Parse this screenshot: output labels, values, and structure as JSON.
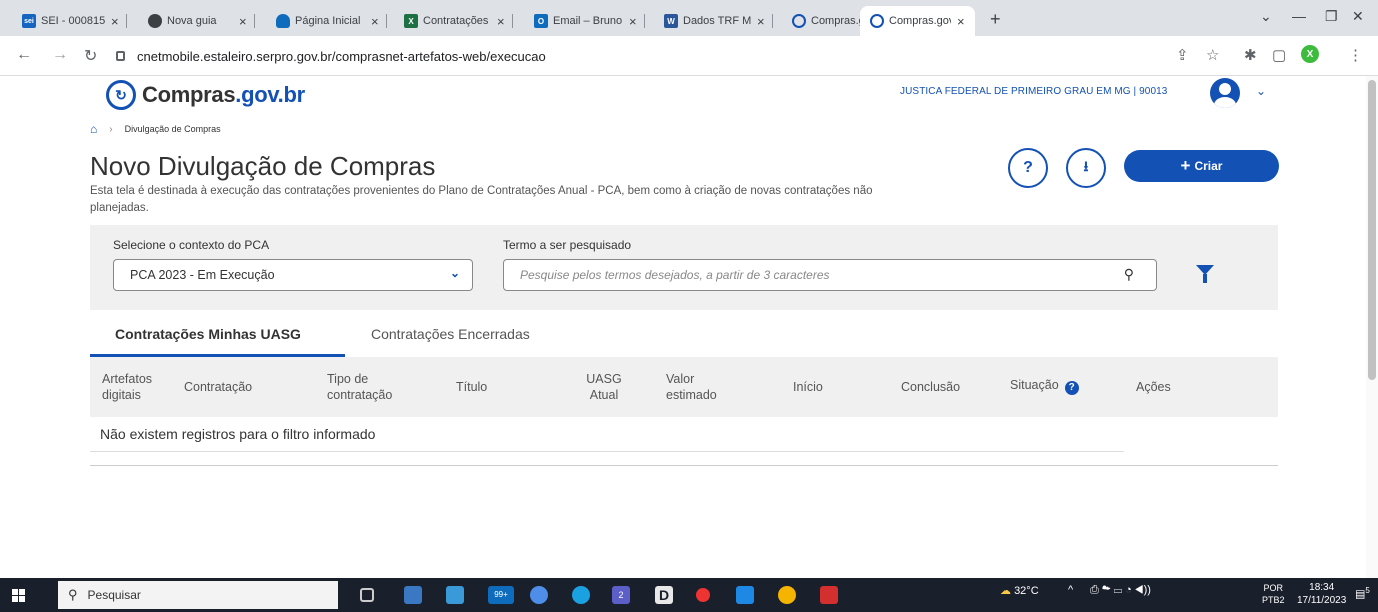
{
  "browser": {
    "tabs": [
      {
        "title": "SEI - 000815",
        "favicon_label": "sei",
        "favicon_color": "#1565c0",
        "active": false
      },
      {
        "title": "Nova guia",
        "favicon_label": "",
        "favicon_color": "#3c4043",
        "active": false
      },
      {
        "title": "Página Inicial",
        "favicon_label": "",
        "favicon_color": "#0f6cbd",
        "active": false
      },
      {
        "title": "Contratações",
        "favicon_label": "X",
        "favicon_color": "#1d7044",
        "active": false
      },
      {
        "title": "Email – Bruno",
        "favicon_label": "O",
        "favicon_color": "#0f6cbd",
        "active": false
      },
      {
        "title": "Dados TRF M",
        "favicon_label": "W",
        "favicon_color": "#2b579a",
        "active": false
      },
      {
        "title": "Compras.gov",
        "favicon_label": "",
        "favicon_color": "#1351b4",
        "active": false
      },
      {
        "title": "Compras.gov",
        "favicon_label": "",
        "favicon_color": "#1351b4",
        "active": true
      }
    ],
    "new_tab": "+",
    "url": "cnetmobile.estaleiro.serpro.gov.br/comprasnet-artefatos-web/execucao",
    "extension_badge": "X"
  },
  "header": {
    "logo_text_main": "Compras",
    "logo_text_suffix": ".gov.br",
    "organization": "JUSTICA FEDERAL DE PRIMEIRO GRAU EM MG | 90013"
  },
  "breadcrumb": {
    "current": "Divulgação de Compras"
  },
  "page": {
    "title": "Novo Divulgação de Compras",
    "description": "Esta tela é destinada à execução das contratações provenientes do Plano de Contratações Anual - PCA, bem como à criação de novas contratações não planejadas.",
    "help_label": "?",
    "create_label": "Criar"
  },
  "filters": {
    "pca_label": "Selecione o contexto do PCA",
    "pca_value": "PCA 2023 - Em Execução",
    "search_label": "Termo a ser pesquisado",
    "search_placeholder": "Pesquise pelos termos desejados, a partir de 3 caracteres"
  },
  "tabs": [
    {
      "label": "Contratações Minhas UASG",
      "active": true
    },
    {
      "label": "Contratações Encerradas",
      "active": false
    }
  ],
  "table": {
    "columns": [
      "Artefatos digitais",
      "Contratação",
      "Tipo de contratação",
      "Título",
      "UASG Atual",
      "Valor estimado",
      "Início",
      "Conclusão",
      "Situação",
      "Ações"
    ],
    "empty_message": "Não existem registros para o filtro informado"
  },
  "taskbar": {
    "search_label": "Pesquisar",
    "weather": "32°C",
    "language_top": "POR",
    "language_bottom": "PTB2",
    "time": "18:34",
    "date": "17/11/2023",
    "notifications": "5",
    "mail_badge": "99+",
    "teams_badge": "2"
  },
  "colors": {
    "accent": "#1351b4",
    "panel": "#f0f0f0"
  }
}
